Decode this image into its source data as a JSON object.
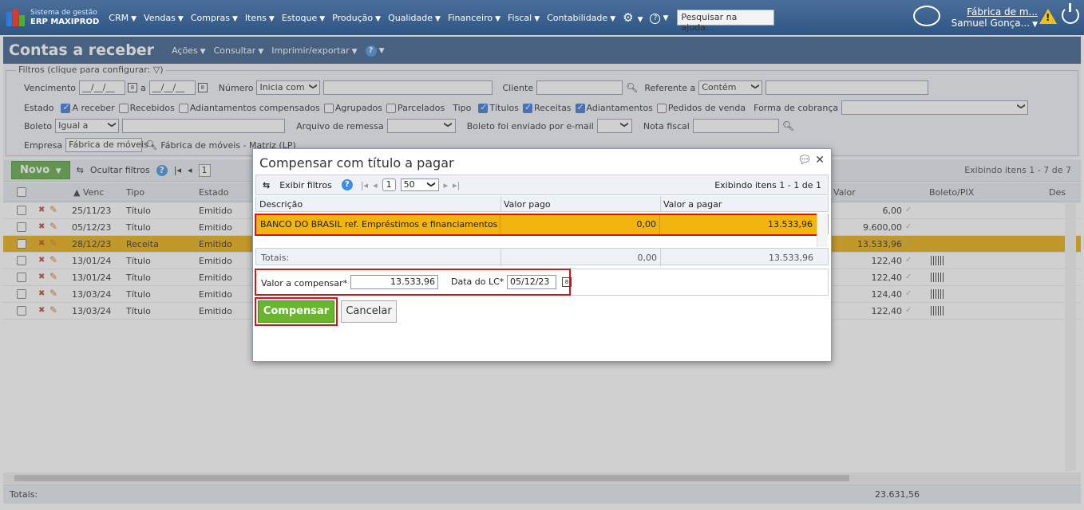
{
  "app": {
    "logo_sub": "Sistema de gestão",
    "logo_main": "ERP MAXIPROD",
    "menu": [
      "CRM",
      "Vendas",
      "Compras",
      "Itens",
      "Estoque",
      "Produção",
      "Qualidade",
      "Financeiro",
      "Fiscal",
      "Contabilidade"
    ],
    "search_placeholder": "Pesquisar na ajuda...",
    "company": "Fábrica de m...",
    "user": "Samuel Gonça..."
  },
  "page": {
    "title": "Contas a receber",
    "menus": [
      "Ações",
      "Consultar",
      "Imprimir/exportar"
    ],
    "help": "?"
  },
  "filters": {
    "legend": "Filtros (clique para configurar:",
    "vencimento_label": "Vencimento",
    "date_placeholder": "__/__/__",
    "a_label": "a",
    "numero_label": "Número",
    "numero_mode": "Inicia com",
    "cliente_label": "Cliente",
    "referente_label": "Referente a",
    "referente_mode": "Contém",
    "estado_label": "Estado",
    "estado_opts": [
      {
        "label": "A receber",
        "on": true
      },
      {
        "label": "Recebidos",
        "on": false
      },
      {
        "label": "Adiantamentos compensados",
        "on": false
      },
      {
        "label": "Agrupados",
        "on": false
      },
      {
        "label": "Parcelados",
        "on": false
      }
    ],
    "tipo_label": "Tipo",
    "tipo_opts": [
      {
        "label": "Títulos",
        "on": true
      },
      {
        "label": "Receitas",
        "on": true
      },
      {
        "label": "Adiantamentos",
        "on": true
      },
      {
        "label": "Pedidos de venda",
        "on": false
      }
    ],
    "forma_label": "Forma de cobrança",
    "boleto_label": "Boleto",
    "boleto_mode": "Igual a",
    "arquivo_label": "Arquivo de remessa",
    "email_label": "Boleto foi enviado por e-mail",
    "nf_label": "Nota fiscal",
    "empresa_label": "Empresa",
    "empresa_value": "Fábrica de móveis -",
    "empresa_full": "Fábrica de móveis - Matriz (LP)"
  },
  "grid": {
    "novo": "Novo",
    "hide_filters": "Ocultar filtros",
    "page": "1",
    "showing": "Exibindo itens 1 - 7 de 7",
    "columns": [
      "Venc",
      "Tipo",
      "Estado",
      "Valor",
      "Boleto/PIX",
      "Des"
    ],
    "rows": [
      {
        "venc": "25/11/23",
        "tipo": "Título",
        "estado": "Emitido",
        "valor": "6,00",
        "barcode": false,
        "selected": false
      },
      {
        "venc": "05/12/23",
        "tipo": "Título",
        "estado": "Emitido",
        "valor": "9.600,00",
        "barcode": false,
        "selected": false
      },
      {
        "venc": "28/12/23",
        "tipo": "Receita",
        "estado": "Emitido",
        "valor": "13.533,96",
        "barcode": false,
        "selected": true
      },
      {
        "venc": "13/01/24",
        "tipo": "Título",
        "estado": "Emitido",
        "valor": "122,40",
        "barcode": true,
        "selected": false
      },
      {
        "venc": "13/01/24",
        "tipo": "Título",
        "estado": "Emitido",
        "valor": "122,40",
        "barcode": true,
        "selected": false
      },
      {
        "venc": "13/03/24",
        "tipo": "Título",
        "estado": "Emitido",
        "valor": "124,40",
        "barcode": true,
        "selected": false
      },
      {
        "venc": "13/03/24",
        "tipo": "Título",
        "estado": "Emitido",
        "valor": "122,40",
        "barcode": true,
        "selected": false
      }
    ],
    "totals_label": "Totais:",
    "totals_value": "23.631,56"
  },
  "modal": {
    "title": "Compensar com título a pagar",
    "show_filters": "Exibir filtros",
    "page": "1",
    "page_size": "50",
    "showing": "Exibindo itens 1 - 1 de 1",
    "columns": [
      "Descrição",
      "Valor pago",
      "Valor a pagar"
    ],
    "row": {
      "descricao": "BANCO DO BRASIL ref. Empréstimos e financiamentos",
      "valor_pago": "0,00",
      "valor_a_pagar": "13.533,96"
    },
    "totals_label": "Totais:",
    "totals_pago": "0,00",
    "totals_a_pagar": "13.533,96",
    "valor_label": "Valor a compensar*",
    "valor_value": "13.533,96",
    "data_label": "Data do LC*",
    "data_value": "05/12/23",
    "compensar": "Compensar",
    "cancelar": "Cancelar"
  }
}
